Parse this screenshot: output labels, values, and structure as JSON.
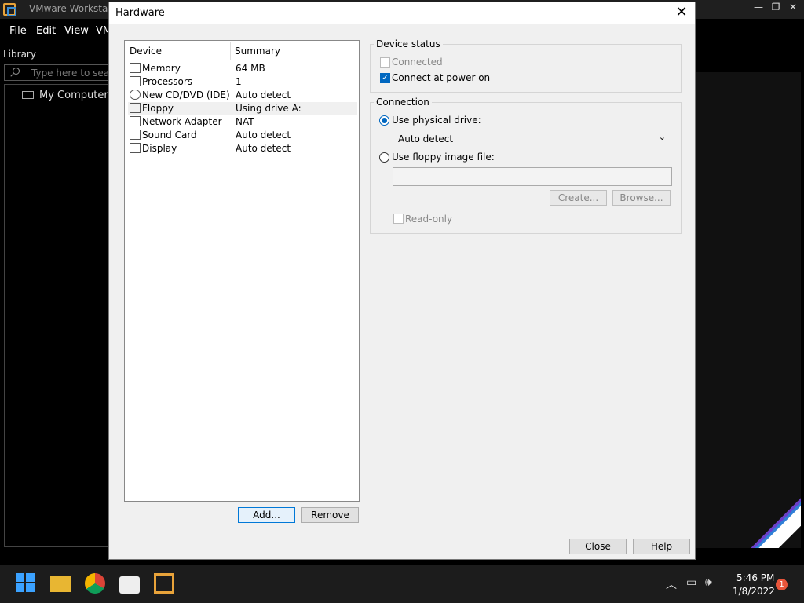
{
  "vmware": {
    "title": "VMware Workstatio",
    "menu": [
      {
        "label": "File"
      },
      {
        "label": "Edit"
      },
      {
        "label": "View"
      },
      {
        "label": "VM"
      }
    ],
    "library_label": "Library",
    "search_placeholder": "Type here to search",
    "tree_item": "My Computer"
  },
  "dialog": {
    "title": "Hardware",
    "device_list": {
      "col_device": "Device",
      "col_summary": "Summary",
      "rows": [
        {
          "device": "Memory",
          "summary": "64 MB",
          "icon": "memory-icon"
        },
        {
          "device": "Processors",
          "summary": "1",
          "icon": "processor-icon"
        },
        {
          "device": "New CD/DVD (IDE)",
          "summary": "Auto detect",
          "icon": "cd-dvd-icon"
        },
        {
          "device": "Floppy",
          "summary": "Using drive A:",
          "icon": "floppy-icon",
          "selected": true
        },
        {
          "device": "Network Adapter",
          "summary": "NAT",
          "icon": "network-adapter-icon"
        },
        {
          "device": "Sound Card",
          "summary": "Auto detect",
          "icon": "sound-card-icon"
        },
        {
          "device": "Display",
          "summary": "Auto detect",
          "icon": "display-icon"
        }
      ],
      "add_label": "Add...",
      "remove_label": "Remove"
    },
    "device_status": {
      "legend": "Device status",
      "connected_label": "Connected",
      "connected_checked": false,
      "connect_power_label": "Connect at power on",
      "connect_power_checked": true
    },
    "connection": {
      "legend": "Connection",
      "physical_label": "Use physical drive:",
      "physical_selected": true,
      "drive_value": "Auto detect",
      "image_label": "Use floppy image file:",
      "image_selected": false,
      "image_value": "",
      "create_label": "Create...",
      "browse_label": "Browse...",
      "readonly_label": "Read-only",
      "readonly_checked": false
    },
    "close_label": "Close",
    "help_label": "Help"
  },
  "taskbar": {
    "time": "5:46 PM",
    "date": "1/8/2022",
    "notifications": "1"
  },
  "colors": {
    "accent": "#0067c0",
    "titlebar_dark": "#1f1f1f"
  }
}
